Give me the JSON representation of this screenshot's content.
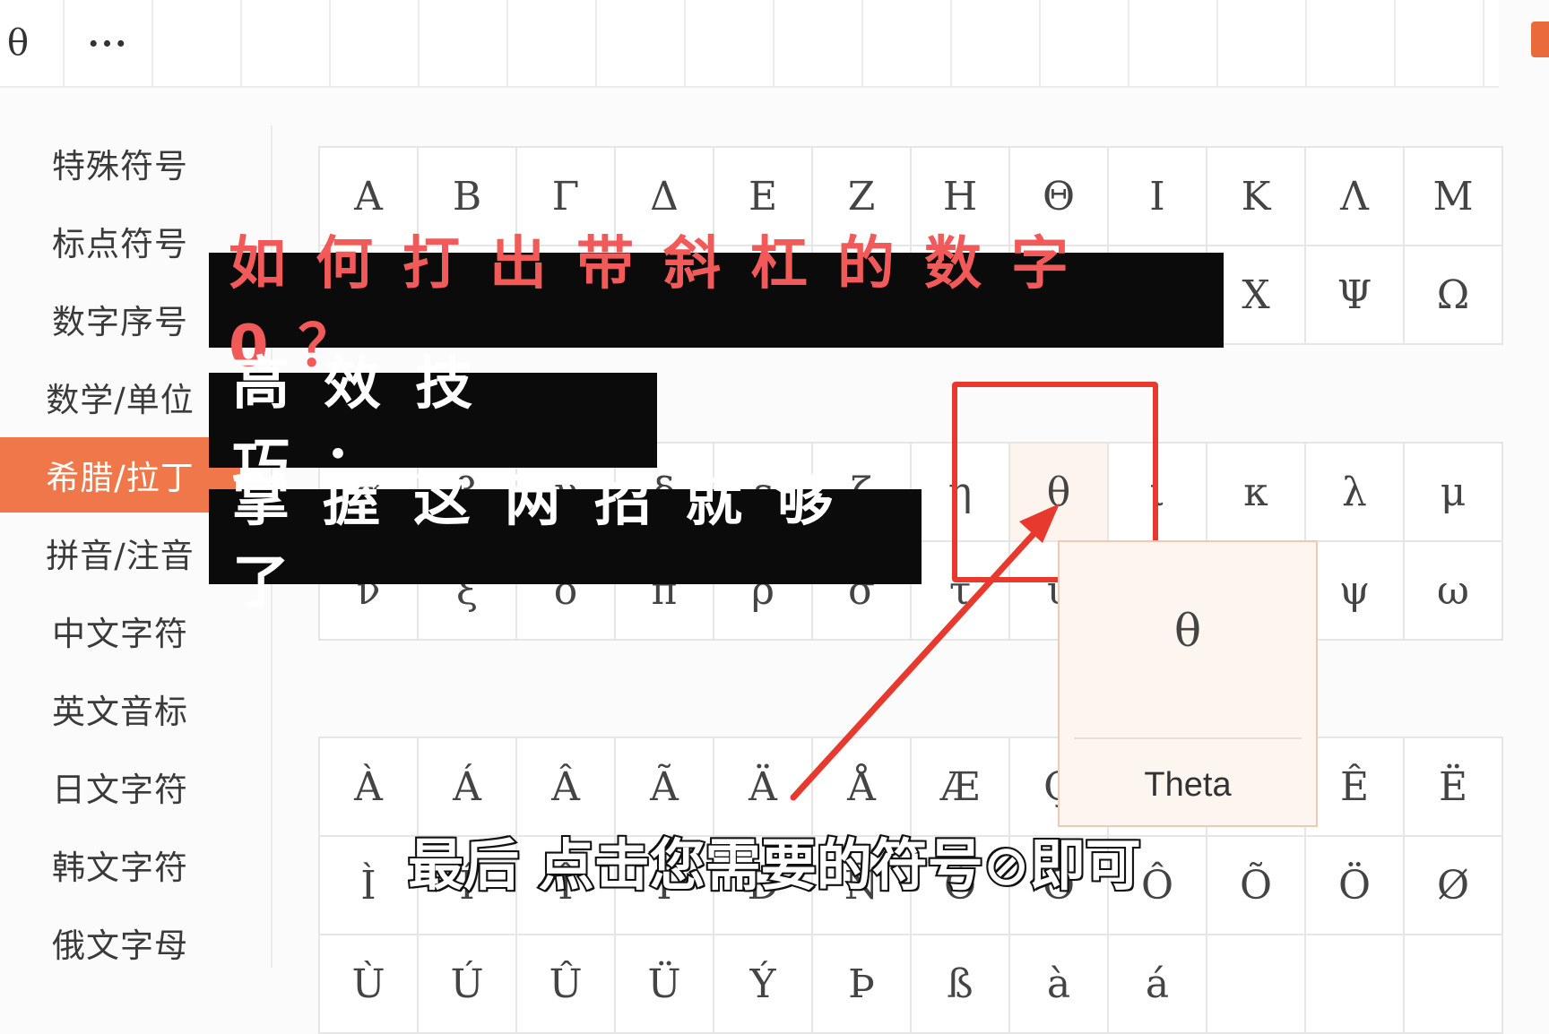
{
  "recent_symbols": {
    "first": "θ",
    "more_label": "···"
  },
  "sidebar": {
    "items": [
      {
        "label": "特殊符号",
        "active": false
      },
      {
        "label": "标点符号",
        "active": false
      },
      {
        "label": "数字序号",
        "active": false
      },
      {
        "label": "数学/单位",
        "active": false
      },
      {
        "label": "希腊/拉丁",
        "active": true
      },
      {
        "label": "拼音/注音",
        "active": false
      },
      {
        "label": "中文字符",
        "active": false
      },
      {
        "label": "英文音标",
        "active": false
      },
      {
        "label": "日文字符",
        "active": false
      },
      {
        "label": "韩文字符",
        "active": false
      },
      {
        "label": "俄文字母",
        "active": false
      }
    ]
  },
  "greek_upper": [
    [
      "Α",
      "Β",
      "Γ",
      "Δ",
      "Ε",
      "Ζ",
      "Η",
      "Θ",
      "Ι",
      "Κ",
      "Λ",
      "Μ"
    ],
    [
      "",
      "",
      "",
      "",
      "",
      "",
      "",
      "",
      "",
      "Χ",
      "Ψ",
      "Ω"
    ]
  ],
  "greek_lower": [
    [
      "α",
      "β",
      "γ",
      "δ",
      "ε",
      "ζ",
      "η",
      "θ",
      "ι",
      "κ",
      "λ",
      "μ"
    ],
    [
      "ν",
      "ξ",
      "ο",
      "π",
      "ρ",
      "σ",
      "τ",
      "υ",
      "",
      "",
      "ψ",
      "ω"
    ]
  ],
  "latin": [
    [
      "À",
      "Á",
      "Â",
      "Ã",
      "Ä",
      "Å",
      "Æ",
      "Ç",
      "",
      "",
      "Ê",
      "Ë"
    ],
    [
      "Ì",
      "Í",
      "Î",
      "Ï",
      "Ð",
      "Ñ",
      "Ò",
      "Ó",
      "Ô",
      "Õ",
      "Ö",
      "Ø"
    ],
    [
      "Ù",
      "Ú",
      "Û",
      "Ü",
      "Ý",
      "Þ",
      "ß",
      "à",
      "á",
      "",
      "",
      ""
    ]
  ],
  "tooltip": {
    "symbol": "θ",
    "name": "Theta"
  },
  "overlay": {
    "title_line_1": "如何打出带斜杠的数字0？",
    "title_line_2": "高效技巧：",
    "title_line_3": "掌握这两招就够了",
    "subtitle": "最后 点击您需要的符号⊘即可"
  },
  "colors": {
    "accent": "#f0774a",
    "highlight_red": "#e8392e",
    "title_red": "#f25a5a"
  }
}
